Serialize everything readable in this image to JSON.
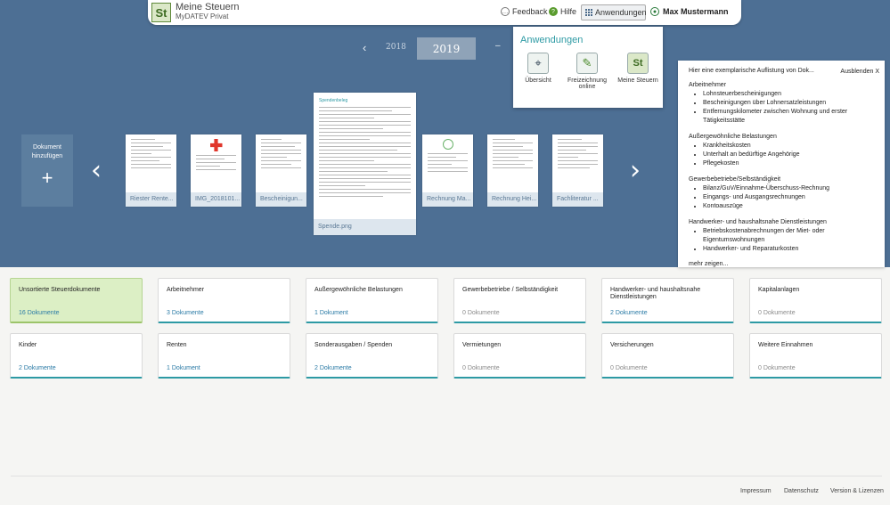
{
  "header": {
    "logo_text": "St",
    "title": "Meine Steuern",
    "subtitle": "MyDATEV Privat",
    "feedback": "Feedback",
    "help": "Hilfe",
    "apps": "Anwendungen",
    "user": "Max Mustermann"
  },
  "years": {
    "prev_arrow": "‹",
    "prev": "2018",
    "current": "2019",
    "next": "–"
  },
  "apps_popup": {
    "title": "Anwendungen",
    "items": [
      {
        "label": "Übersicht",
        "icon": "telescope-icon"
      },
      {
        "label": "Freizeichnung online",
        "icon": "feather-icon"
      },
      {
        "label": "Meine Steuern",
        "icon": "meine-steuern-icon"
      }
    ]
  },
  "carousel": {
    "add_label": "Dokument hinzufügen",
    "add_plus": "+",
    "prev": "‹",
    "next": "›",
    "docs": [
      {
        "caption": "Riester Rente..."
      },
      {
        "caption": "IMG_2018101..."
      },
      {
        "caption": "Bescheinigun..."
      },
      {
        "caption": "Spende.png",
        "thumb_title": "Spendenbeleg"
      },
      {
        "caption": "Rechnung Ma..."
      },
      {
        "caption": "Rechnung Hei..."
      },
      {
        "caption": "Fachliteratur ..."
      }
    ]
  },
  "info_panel": {
    "title": "Hier eine exemplarische Auflistung von Dok...",
    "hide": "Ausblenden X",
    "sections": [
      {
        "heading": "Arbeitnehmer",
        "items": [
          "Lohnsteuerbescheinigungen",
          "Bescheinigungen über Lohnersatzleistungen",
          "Entfernungskilometer zwischen Wohnung und erster Tätigkeitsstätte"
        ]
      },
      {
        "heading": "Außergewöhnliche Belastungen",
        "items": [
          "Krankheitskosten",
          "Unterhalt an bedürftige Angehörige",
          "Pflegekosten"
        ]
      },
      {
        "heading": "Gewerbebetriebe/Selbständigkeit",
        "items": [
          "Bilanz/GuV/Einnahme-Überschuss-Rechnung",
          "Eingangs- und Ausgangsrechnungen",
          "Kontoauszüge"
        ]
      },
      {
        "heading": "Handwerker- und haushaltsnahe Dienstleistungen",
        "items": [
          "Betriebskostenabrechnungen der Miet- oder Eigentumswohnungen",
          "Handwerker- und Reparaturkosten"
        ]
      }
    ],
    "more": "mehr zeigen..."
  },
  "categories": [
    {
      "title": "Unsortierte Steuerdokumente",
      "count": "16 Dokumente"
    },
    {
      "title": "Arbeitnehmer",
      "count": "3 Dokumente"
    },
    {
      "title": "Außergewöhnliche Belastungen",
      "count": "1 Dokument"
    },
    {
      "title": "Gewerbebetriebe / Selbständigkeit",
      "count": "0 Dokumente"
    },
    {
      "title": "Handwerker- und haushaltsnahe Dienstleistungen",
      "count": "2 Dokumente"
    },
    {
      "title": "Kapitalanlagen",
      "count": "0 Dokumente"
    },
    {
      "title": "Kinder",
      "count": "2 Dokumente"
    },
    {
      "title": "Renten",
      "count": "1 Dokument"
    },
    {
      "title": "Sonderausgaben / Spenden",
      "count": "2 Dokumente"
    },
    {
      "title": "Vermietungen",
      "count": "0 Dokumente"
    },
    {
      "title": "Versicherungen",
      "count": "0 Dokumente"
    },
    {
      "title": "Weitere Einnahmen",
      "count": "0 Dokumente"
    }
  ],
  "footer": {
    "impressum": "Impressum",
    "datenschutz": "Datenschutz",
    "version": "Version & Lizenzen"
  },
  "colors": {
    "hero": "#4d6f94",
    "accent": "#2d9aa4",
    "active_card": "#dcefc5"
  }
}
